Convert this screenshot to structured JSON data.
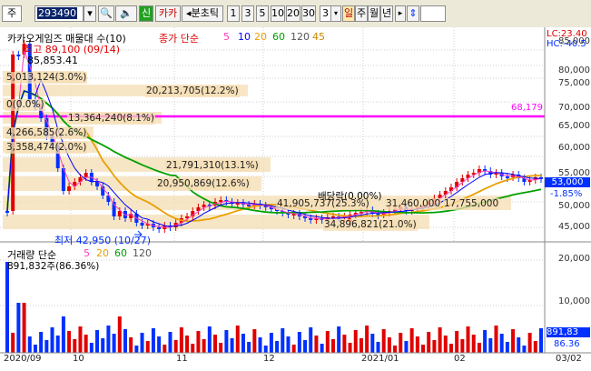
{
  "toolbar": {
    "market": "주",
    "code": "293490",
    "btn_new": "신",
    "btn_kakao": "카카",
    "btn_analysis": "분초틱",
    "periods": [
      "1",
      "3",
      "5",
      "10",
      "20",
      "30"
    ],
    "count": "3",
    "units": [
      "일",
      "주",
      "월",
      "년"
    ]
  },
  "chart": {
    "title": "카카오게임즈 매물대 수(10)",
    "ma_label": "종가 단순",
    "ma_periods": [
      "5",
      "10",
      "20",
      "60",
      "120",
      "45"
    ],
    "lc": "LC:23.40",
    "hc": "HC:-40.5",
    "high_label": "최고 89,100 (09/14)",
    "low_label": "최저 42,950 (10/27)",
    "price_85853": "85,853.41",
    "ann_1": "5,013,124(3.0%)",
    "ann_2": "20,213,705(12.2%)",
    "ann_3": "0(0.0%)",
    "ann_4": "13,364,240(8.1%)",
    "ann_5": "4,266,585(2.6%)",
    "ann_6": "3,358,474(2.0%)",
    "ann_7": "21,791,310(13.1%)",
    "ann_8": "20,950,869(12.6%)",
    "ann_9": "41,905,737(25.3%)",
    "ann_10": "31,460,000",
    "ann_11": "17,755,000",
    "ann_12": "34,896,821(21.0%)",
    "dividend": "배당락(0.00%)",
    "hline_value": "68,179",
    "last_price": "53,000",
    "last_pct": "-1.85%",
    "y_ticks": [
      "85,000",
      "80,000",
      "75,000",
      "70,000",
      "65,000",
      "60,000",
      "55,000",
      "50,000",
      "45,000"
    ],
    "volume_label": "거래량 단순",
    "vol_ma": [
      "5",
      "20",
      "60",
      "120"
    ],
    "vol_pct": "891,832주(86.36%)",
    "vol_ticks": [
      "20,000",
      "10,000"
    ],
    "vol_last": "891,83",
    "vol_last2": "86.36",
    "x_labels": [
      "2020/09",
      "10",
      "11",
      "12",
      "2021/01",
      "02",
      "03/02"
    ],
    "colors": {
      "up": "#e00000",
      "down": "#0030ff",
      "hline": "#ff00ff",
      "ma5": "#ff3cc0",
      "ma10": "#0000ff",
      "ma20": "#e8a000",
      "ma60": "#00a000"
    }
  }
}
